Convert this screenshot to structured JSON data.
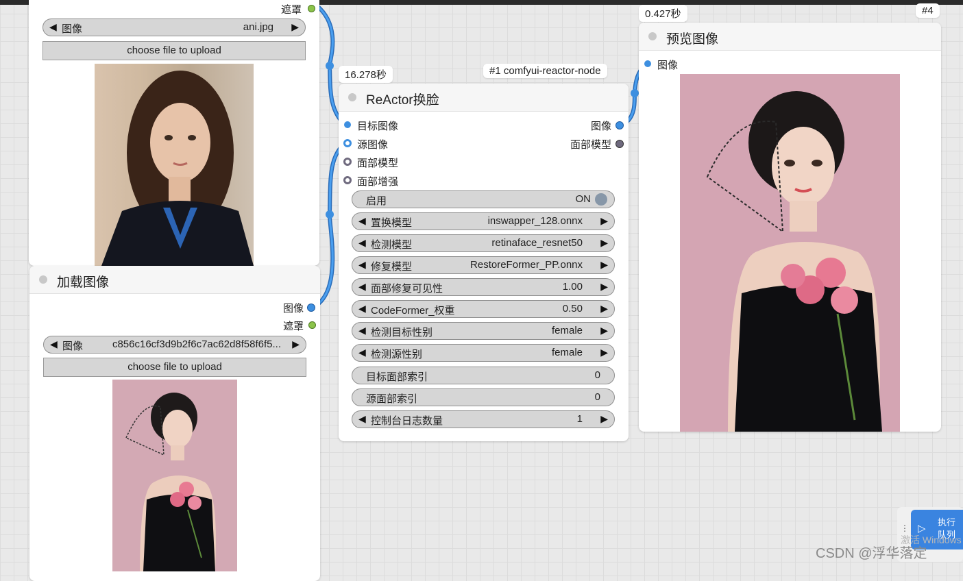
{
  "load_node_1": {
    "output_mask_label": "遮罩",
    "image_widget": {
      "label": "图像",
      "value": "ani.jpg"
    },
    "upload_label": "choose file to upload"
  },
  "load_node_2": {
    "title": "加载图像",
    "output_image_label": "图像",
    "output_mask_label": "遮罩",
    "image_widget": {
      "label": "图像",
      "value": "c856c16cf3d9b2f6c7ac62d8f58f6f5..."
    },
    "upload_label": "choose file to upload"
  },
  "reactor_node": {
    "time_badge": "16.278秒",
    "id_badge": "#1 comfyui-reactor-node",
    "title": "ReActor换脸",
    "inputs": [
      "目标图像",
      "源图像",
      "面部模型",
      "面部增强"
    ],
    "outputs": [
      "图像",
      "面部模型"
    ],
    "widgets": [
      {
        "label": "启用",
        "value": "ON",
        "kind": "toggle"
      },
      {
        "label": "置换模型",
        "value": "inswapper_128.onnx",
        "kind": "combo"
      },
      {
        "label": "检测模型",
        "value": "retinaface_resnet50",
        "kind": "combo"
      },
      {
        "label": "修复模型",
        "value": "RestoreFormer_PP.onnx",
        "kind": "combo"
      },
      {
        "label": "面部修复可见性",
        "value": "1.00",
        "kind": "combo"
      },
      {
        "label": "CodeFormer_权重",
        "value": "0.50",
        "kind": "combo"
      },
      {
        "label": "检测目标性别",
        "value": "female",
        "kind": "combo"
      },
      {
        "label": "检测源性别",
        "value": "female",
        "kind": "combo"
      },
      {
        "label": "目标面部索引",
        "value": "0",
        "kind": "text"
      },
      {
        "label": "源面部索引",
        "value": "0",
        "kind": "text"
      },
      {
        "label": "控制台日志数量",
        "value": "1",
        "kind": "combo"
      }
    ]
  },
  "preview_node": {
    "time_badge": "0.427秒",
    "id_badge": "#4",
    "title": "预览图像",
    "input_label": "图像"
  },
  "queue": {
    "execute_label": "执行队列"
  },
  "overlay": {
    "watermark": "CSDN @浮华落定",
    "activate_hint": "激活 Windows"
  },
  "colors": {
    "image_slot": "#3d8fe0",
    "mask_slot": "#8bc34a",
    "face_model_slot": "#6f6a7e",
    "wire": "#3d8fe0"
  }
}
